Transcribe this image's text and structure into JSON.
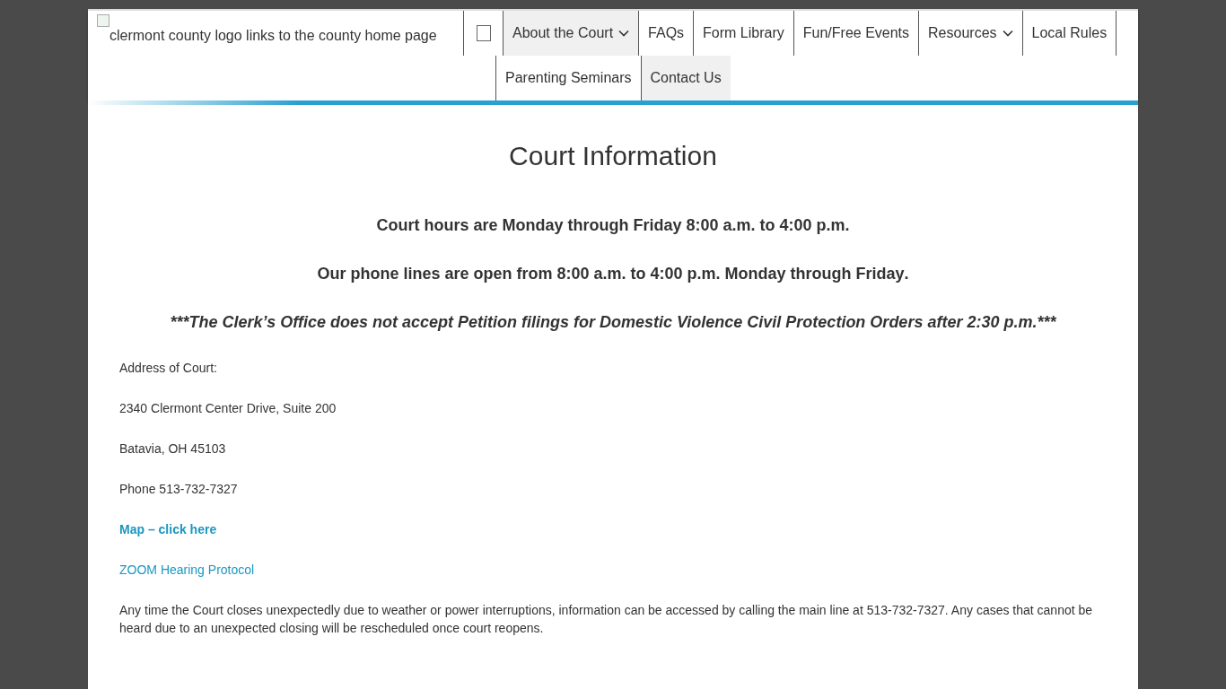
{
  "header": {
    "logo_alt": "clermont county logo links to the county home page"
  },
  "nav": {
    "primary": [
      {
        "kind": "checkbox",
        "checked": false
      },
      {
        "kind": "link",
        "label": "About the Court",
        "dropdown": true,
        "selected": true
      },
      {
        "kind": "link",
        "label": "FAQs",
        "dropdown": false,
        "selected": false
      },
      {
        "kind": "link",
        "label": "Form Library",
        "dropdown": false,
        "selected": false
      },
      {
        "kind": "link",
        "label": "Fun/Free Events",
        "dropdown": false,
        "selected": false
      },
      {
        "kind": "link",
        "label": "Resources",
        "dropdown": true,
        "selected": false
      },
      {
        "kind": "link",
        "label": "Local Rules",
        "dropdown": false,
        "selected": false
      }
    ],
    "secondary": [
      {
        "kind": "link",
        "label": "Parenting Seminars",
        "dropdown": false,
        "selected": false
      },
      {
        "kind": "link",
        "label": "Contact Us",
        "dropdown": false,
        "selected": true
      }
    ]
  },
  "content": {
    "title": "Court Information",
    "notices": [
      {
        "kind": "plain",
        "text": "Court hours are Monday through Friday  8:00 a.m. to 4:00 p.m.",
        "italic": false
      },
      {
        "kind": "marked",
        "text": "**Our phone lines are open from 8:00 a.m. to 4:00 p.m.  Monday through Friday**.",
        "italic": false
      },
      {
        "kind": "plain",
        "text": "***The Clerk’s Office does not accept Petition filings for Domestic Violence Civil Protection Orders after 2:30 p.m.***",
        "italic": true
      }
    ],
    "paragraphs": [
      {
        "kind": "text",
        "text": "Address of Court:"
      },
      {
        "kind": "text",
        "text": "2340 Clermont Center Drive, Suite 200"
      },
      {
        "kind": "text",
        "text": "Batavia, OH 45103"
      },
      {
        "kind": "text",
        "text": "Phone 513-732-7327"
      },
      {
        "kind": "link_bold",
        "text": "Map – click here"
      },
      {
        "kind": "link",
        "text": "ZOOM Hearing Protocol"
      },
      {
        "kind": "text",
        "text": "Any time the Court closes unexpectedly due to weather or power interruptions, information can be accessed by calling the main line at 513-732-7327. Any cases that cannot be heard due to an unexpected closing will be rescheduled once court reopens."
      }
    ]
  }
}
